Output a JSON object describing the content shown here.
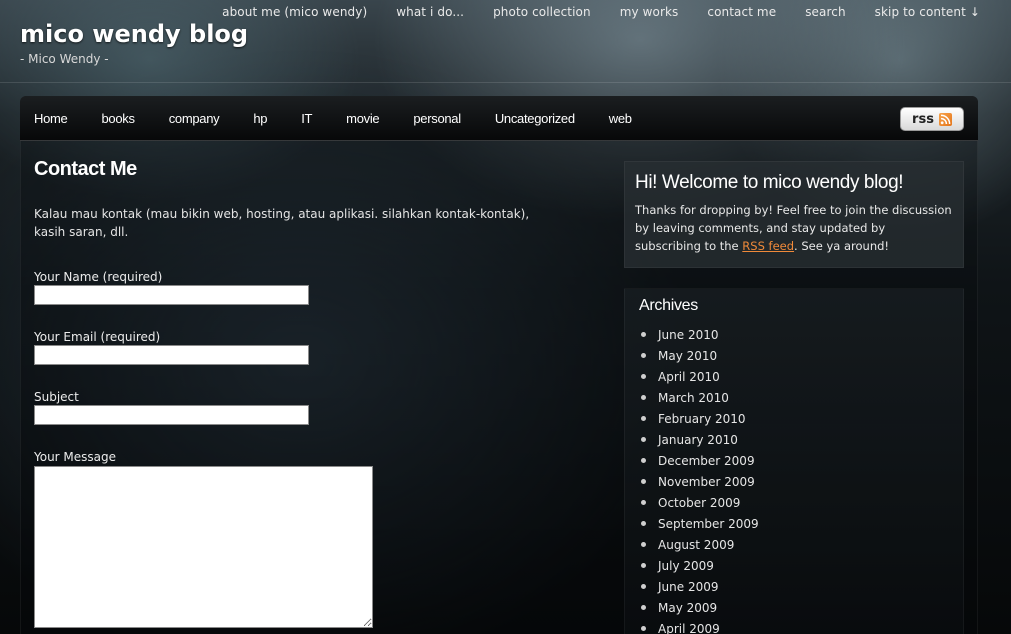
{
  "header": {
    "site_title": "mico wendy blog",
    "site_description": "- Mico Wendy -",
    "top_links": [
      "about me (mico wendy)",
      "what i do...",
      "photo collection",
      "my works",
      "contact me",
      "search",
      "skip to content ↓"
    ]
  },
  "nav": {
    "items": [
      "Home",
      "books",
      "company",
      "hp",
      "IT",
      "movie",
      "personal",
      "Uncategorized",
      "web"
    ],
    "rss_label": "rss"
  },
  "main": {
    "title": "Contact Me",
    "intro": "Kalau mau kontak (mau bikin web, hosting, atau aplikasi. silahkan kontak-kontak), kasih saran, dll.",
    "form": {
      "name_label": "Your Name (required)",
      "email_label": "Your Email (required)",
      "subject_label": "Subject",
      "message_label": "Your Message",
      "name_value": "",
      "email_value": "",
      "subject_value": "",
      "message_value": ""
    }
  },
  "sidebar": {
    "welcome": {
      "title": "Hi! Welcome to mico wendy blog!",
      "text_before": "Thanks for dropping by! Feel free to join the discussion by leaving comments, and stay updated by subscribing to the ",
      "link_text": "RSS feed",
      "text_after": ". See ya around!"
    },
    "archives": {
      "title": "Archives",
      "items": [
        "June 2010",
        "May 2010",
        "April 2010",
        "March 2010",
        "February 2010",
        "January 2010",
        "December 2009",
        "November 2009",
        "October 2009",
        "September 2009",
        "August 2009",
        "July 2009",
        "June 2009",
        "May 2009",
        "April 2009"
      ]
    }
  },
  "colors": {
    "link_accent": "#f08a3a",
    "rss_orange": "#e4761c"
  }
}
